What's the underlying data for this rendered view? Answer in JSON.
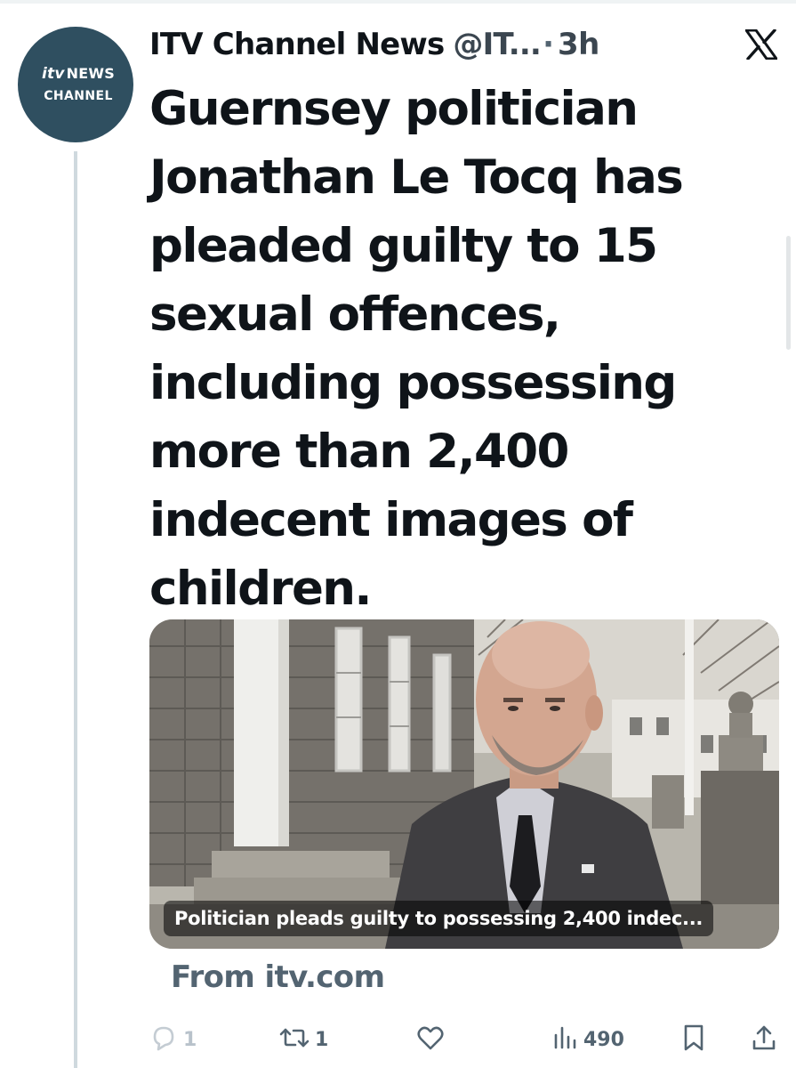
{
  "avatar": {
    "logo_prefix": "itv",
    "logo_word": "NEWS",
    "logo_sub": "CHANNEL"
  },
  "header": {
    "display_name": "ITV Channel News",
    "handle": "@IT...",
    "separator": "·",
    "time": "3h",
    "platform_icon": "x-logo-icon"
  },
  "tweet": {
    "text_lines": [
      "Guernsey politician",
      "Jonathan Le Tocq has",
      "pleaded guilty to 15",
      "sexual offences,",
      "including possessing",
      "more than 2,400",
      "indecent images of",
      "children."
    ]
  },
  "card": {
    "caption": "Politician pleads guilty to possessing 2,400 indec...",
    "source": "From itv.com"
  },
  "actions": {
    "replies": "1",
    "reposts": "1",
    "views": "490",
    "icons": [
      "reply-icon",
      "repost-icon",
      "like-icon",
      "views-icon",
      "bookmark-icon",
      "share-icon"
    ]
  },
  "colors": {
    "text_primary": "#0f1419",
    "text_secondary": "#536471",
    "avatar_bg": "#2f4f60",
    "thread_line": "#cfd9de"
  }
}
